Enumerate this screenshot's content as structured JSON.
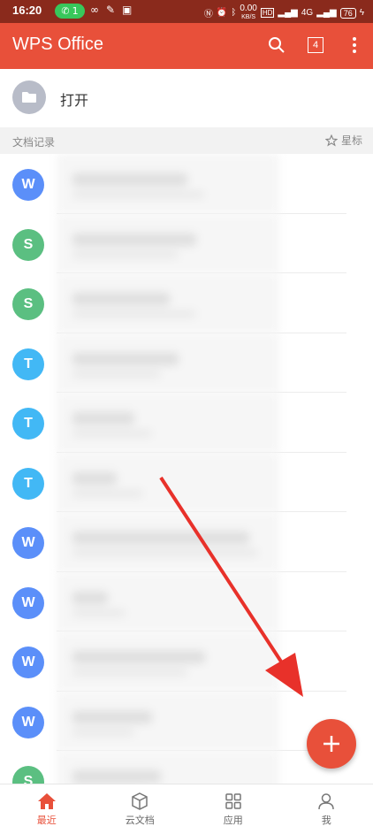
{
  "status_bar": {
    "time": "16:20",
    "signal_pill": "1",
    "network_speed": "0.00",
    "network_unit": "KB/S",
    "battery": "76",
    "lte_label": "4G",
    "hd_label": "HD"
  },
  "app_bar": {
    "title": "WPS Office",
    "tab_count": "4",
    "color": "#e8503a"
  },
  "open": {
    "label": "打开"
  },
  "section": {
    "title": "文档记录",
    "star_label": "星标"
  },
  "documents": [
    {
      "type_letter": "W",
      "color": "#5b8ff9",
      "title_w": 130,
      "sub_w": 150
    },
    {
      "type_letter": "S",
      "color": "#5bbf81",
      "title_w": 140,
      "sub_w": 120
    },
    {
      "type_letter": "S",
      "color": "#5bbf81",
      "title_w": 110,
      "sub_w": 140
    },
    {
      "type_letter": "T",
      "color": "#42b8f5",
      "title_w": 120,
      "sub_w": 100
    },
    {
      "type_letter": "T",
      "color": "#42b8f5",
      "title_w": 70,
      "sub_w": 90
    },
    {
      "type_letter": "T",
      "color": "#42b8f5",
      "title_w": 50,
      "sub_w": 80
    },
    {
      "type_letter": "W",
      "color": "#5b8ff9",
      "title_w": 200,
      "sub_w": 210
    },
    {
      "type_letter": "W",
      "color": "#5b8ff9",
      "title_w": 40,
      "sub_w": 60
    },
    {
      "type_letter": "W",
      "color": "#5b8ff9",
      "title_w": 150,
      "sub_w": 130
    },
    {
      "type_letter": "W",
      "color": "#5b8ff9",
      "title_w": 90,
      "sub_w": 70
    },
    {
      "type_letter": "S",
      "color": "#5bbf81",
      "title_w": 100,
      "sub_w": 80
    }
  ],
  "bottom_nav": [
    {
      "label": "最近",
      "active": true
    },
    {
      "label": "云文档",
      "active": false
    },
    {
      "label": "应用",
      "active": false
    },
    {
      "label": "我",
      "active": false
    }
  ]
}
